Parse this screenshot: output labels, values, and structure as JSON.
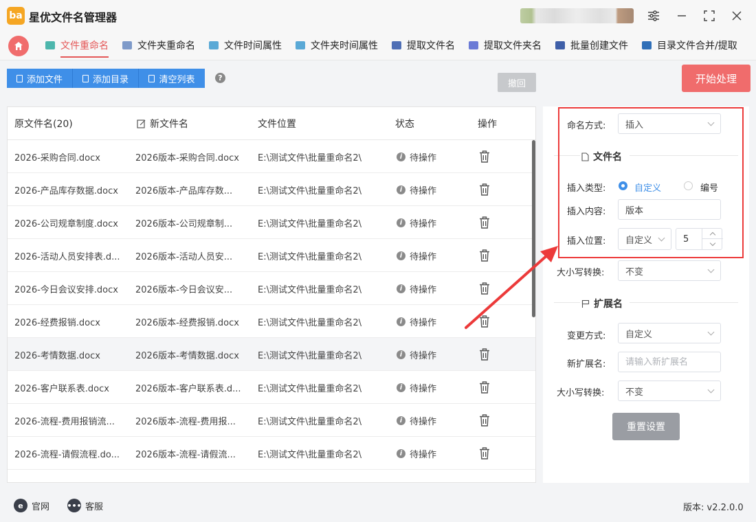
{
  "app": {
    "title": "星优文件名管理器",
    "logo_text": "ba"
  },
  "nav": {
    "tabs": [
      {
        "label": "文件重命名",
        "color": "#4db6ac"
      },
      {
        "label": "文件夹重命名",
        "color": "#7e9ac9"
      },
      {
        "label": "文件时间属性",
        "color": "#5aa9d6"
      },
      {
        "label": "文件夹时间属性",
        "color": "#5aa9d6"
      },
      {
        "label": "提取文件名",
        "color": "#4f6fb5"
      },
      {
        "label": "提取文件夹名",
        "color": "#6b7bd6"
      },
      {
        "label": "批量创建文件",
        "color": "#3f5fa8"
      },
      {
        "label": "目录文件合并/提取",
        "color": "#2f6fb8"
      }
    ]
  },
  "toolbar": {
    "add_file": "添加文件",
    "add_dir": "添加目录",
    "clear_list": "清空列表",
    "undo": "撤回",
    "start": "开始处理"
  },
  "table": {
    "headers": {
      "original": "原文件名(20)",
      "new": "新文件名",
      "location": "文件位置",
      "status": "状态",
      "action": "操作"
    },
    "rows": [
      {
        "original": "2026-采购合同.docx",
        "new": "2026版本-采购合同.docx",
        "location": "E:\\测试文件\\批量重命名2\\",
        "status": "待操作"
      },
      {
        "original": "2026-产品库存数据.docx",
        "new": "2026版本-产品库存数...",
        "location": "E:\\测试文件\\批量重命名2\\",
        "status": "待操作"
      },
      {
        "original": "2026-公司规章制度.docx",
        "new": "2026版本-公司规章制...",
        "location": "E:\\测试文件\\批量重命名2\\",
        "status": "待操作"
      },
      {
        "original": "2026-活动人员安排表.d...",
        "new": "2026版本-活动人员安...",
        "location": "E:\\测试文件\\批量重命名2\\",
        "status": "待操作"
      },
      {
        "original": "2026-今日会议安排.docx",
        "new": "2026版本-今日会议安...",
        "location": "E:\\测试文件\\批量重命名2\\",
        "status": "待操作"
      },
      {
        "original": "2026-经费报销.docx",
        "new": "2026版本-经费报销.docx",
        "location": "E:\\测试文件\\批量重命名2\\",
        "status": "待操作"
      },
      {
        "original": "2026-考情数据.docx",
        "new": "2026版本-考情数据.docx",
        "location": "E:\\测试文件\\批量重命名2\\",
        "status": "待操作"
      },
      {
        "original": "2026-客户联系表.docx",
        "new": "2026版本-客户联系表.d...",
        "location": "E:\\测试文件\\批量重命名2\\",
        "status": "待操作"
      },
      {
        "original": "2026-流程-费用报销流...",
        "new": "2026版本-流程-费用报...",
        "location": "E:\\测试文件\\批量重命名2\\",
        "status": "待操作"
      },
      {
        "original": "2026-流程-请假流程.do...",
        "new": "2026版本-流程-请假流...",
        "location": "E:\\测试文件\\批量重命名2\\",
        "status": "待操作"
      }
    ]
  },
  "settings": {
    "naming_label": "命名方式:",
    "naming_value": "插入",
    "filename_section": "文件名",
    "insert_type_label": "插入类型:",
    "insert_type_custom": "自定义",
    "insert_type_number": "编号",
    "insert_content_label": "插入内容:",
    "insert_content_value": "版本",
    "insert_pos_label": "插入位置:",
    "insert_pos_value": "自定义",
    "insert_pos_number": "5",
    "case_label": "大小写转换:",
    "case_value": "不变",
    "ext_section": "扩展名",
    "change_label": "变更方式:",
    "change_value": "自定义",
    "new_ext_label": "新扩展名:",
    "new_ext_placeholder": "请输入新扩展名",
    "ext_case_label": "大小写转换:",
    "ext_case_value": "不变",
    "reset": "重置设置"
  },
  "statusbar": {
    "website": "官网",
    "support": "客服",
    "version": "版本: v2.2.0.0"
  },
  "colors": {
    "accent_red": "#f06c6c",
    "primary_blue": "#3f8fe8",
    "annotation_red": "#ec3a3a"
  }
}
